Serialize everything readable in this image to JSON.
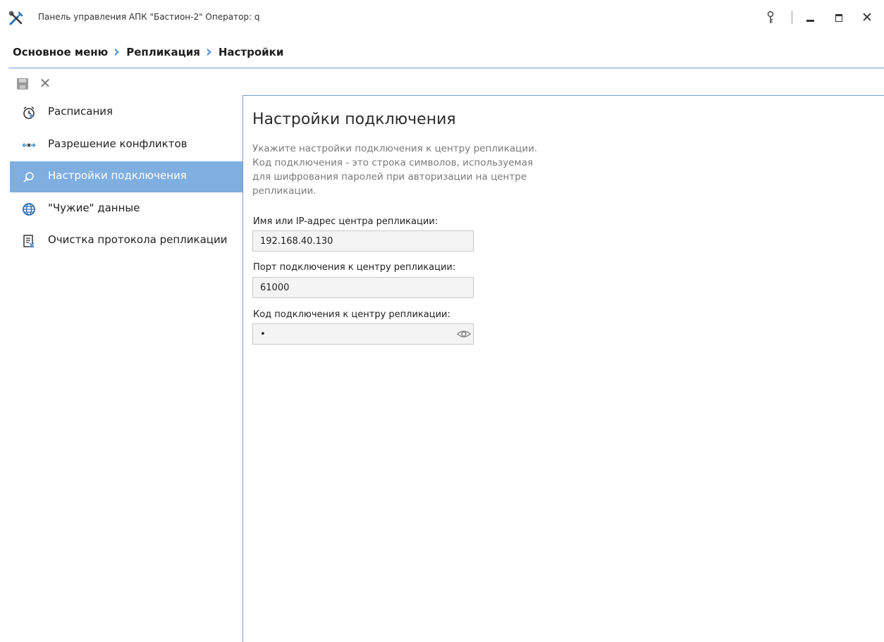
{
  "window": {
    "title": "Панель управления АПК \"Бастион-2\"  Оператор: q",
    "icons": [
      "tools-icon",
      "key-icon",
      "minimize-icon",
      "maximize-icon",
      "close-icon"
    ],
    "close_glyph": "✕"
  },
  "breadcrumb": {
    "items": [
      "Основное меню",
      "Репликация",
      "Настройки"
    ],
    "separator_icon": "chevron-right-icon",
    "separator_color": "#5b9bd5"
  },
  "toolbar": {
    "save_icon": "save-icon",
    "cancel_icon": "cancel-icon",
    "cancel_glyph": "✕"
  },
  "sidebar": {
    "items": [
      {
        "label": "Расписания",
        "icon": "alarm-clock-icon",
        "active": false
      },
      {
        "label": "Разрешение конфликтов",
        "icon": "conflict-icon",
        "active": false
      },
      {
        "label": "Настройки подключения",
        "icon": "connection-icon",
        "active": true
      },
      {
        "label": "\"Чужие\" данные",
        "icon": "globe-icon",
        "active": false
      },
      {
        "label": "Очистка протокола репликации",
        "icon": "clear-log-icon",
        "active": false
      }
    ],
    "active_color": "#7faee0"
  },
  "content": {
    "title": "Настройки подключения",
    "description_lines": [
      "Укажите настройки подключения к центру репликации.",
      "Код подключения - это строка символов, используемая",
      "для шифрования паролей при авторизации на центре",
      "репликации."
    ],
    "fields": {
      "host": {
        "label": "Имя или IP-адрес центра репликации:",
        "value": "192.168.40.130"
      },
      "port": {
        "label": "Порт подключения к центру репликации:",
        "value": "61000"
      },
      "code": {
        "label": "Код подключения к центру репликации:",
        "value": "•",
        "icon": "eye-icon"
      }
    }
  },
  "colors": {
    "accent_line": "#6f9fd3",
    "field_bg": "#f4f4f4",
    "description_text": "#7a7a7a"
  }
}
